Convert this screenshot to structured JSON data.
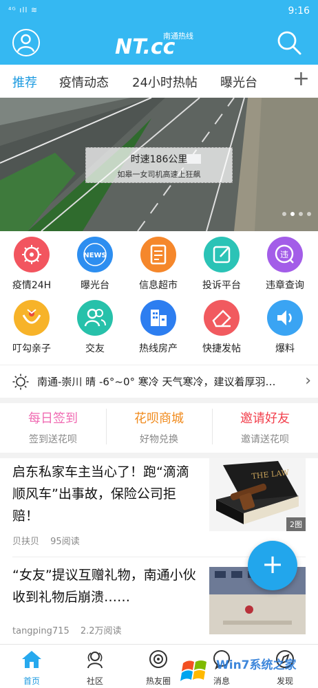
{
  "status_bar": {
    "signal": "⁴ᴳ ıll ≋",
    "time": "9:16"
  },
  "header": {
    "logo_text": "NT.cc",
    "logo_sub": "南通热线"
  },
  "tabs": [
    {
      "label": "推荐",
      "active": true
    },
    {
      "label": "疫情动态"
    },
    {
      "label": "24小时热帖"
    },
    {
      "label": "曝光台"
    }
  ],
  "tab_add": "+",
  "banner": {
    "title": "时速186公里",
    "subtitle": "如皋一女司机高速上狂飙"
  },
  "grid": [
    {
      "label": "疫情24H",
      "icon": "virus-icon",
      "color": "#f2555f"
    },
    {
      "label": "曝光台",
      "icon": "news-icon",
      "color": "#2d8ef0",
      "icon_text": "NEWS"
    },
    {
      "label": "信息超市",
      "icon": "document-icon",
      "color": "#f5872b"
    },
    {
      "label": "投诉平台",
      "icon": "edit-icon",
      "color": "#2bc3b6"
    },
    {
      "label": "违章查询",
      "icon": "violation-icon",
      "color": "#a35de8",
      "icon_text": "违"
    },
    {
      "label": "叮勾亲子",
      "icon": "family-icon",
      "color": "#f7b329"
    },
    {
      "label": "交友",
      "icon": "friends-icon",
      "color": "#27c1aa"
    },
    {
      "label": "热线房产",
      "icon": "building-icon",
      "color": "#2d7ef0"
    },
    {
      "label": "快捷发帖",
      "icon": "eraser-icon",
      "color": "#f15a5f"
    },
    {
      "label": "爆料",
      "icon": "speaker-icon",
      "color": "#3aa4f3"
    }
  ],
  "weather": {
    "text": "南通-崇川 晴 -6°~0° 寒冷 天气寒冷，建议着厚羽…"
  },
  "quick": [
    {
      "title": "每日签到",
      "sub": "签到送花呗",
      "color": "#f06ab2"
    },
    {
      "title": "花呗商城",
      "sub": "好物兑换",
      "color": "#f08a1c"
    },
    {
      "title": "邀请好友",
      "sub": "邀请送花呗",
      "color": "#f2404d"
    }
  ],
  "articles": [
    {
      "title": "启东私家车主当心了！跑“滴滴顺风车”出事故，保险公司拒赔！",
      "author": "贝扶贝",
      "reads": "95阅读",
      "badge": "2图",
      "thumb_text": "THE LAW"
    },
    {
      "title": "“女友”提议互赠礼物，南通小伙收到礼物后崩溃……",
      "author": "tangping715",
      "reads": "2.2万阅读"
    }
  ],
  "fab": "+",
  "bottom_nav": [
    {
      "label": "首页",
      "active": true
    },
    {
      "label": "社区"
    },
    {
      "label": "热友圈"
    },
    {
      "label": "消息"
    },
    {
      "label": "发现"
    }
  ],
  "watermark": "Win7系统之家"
}
